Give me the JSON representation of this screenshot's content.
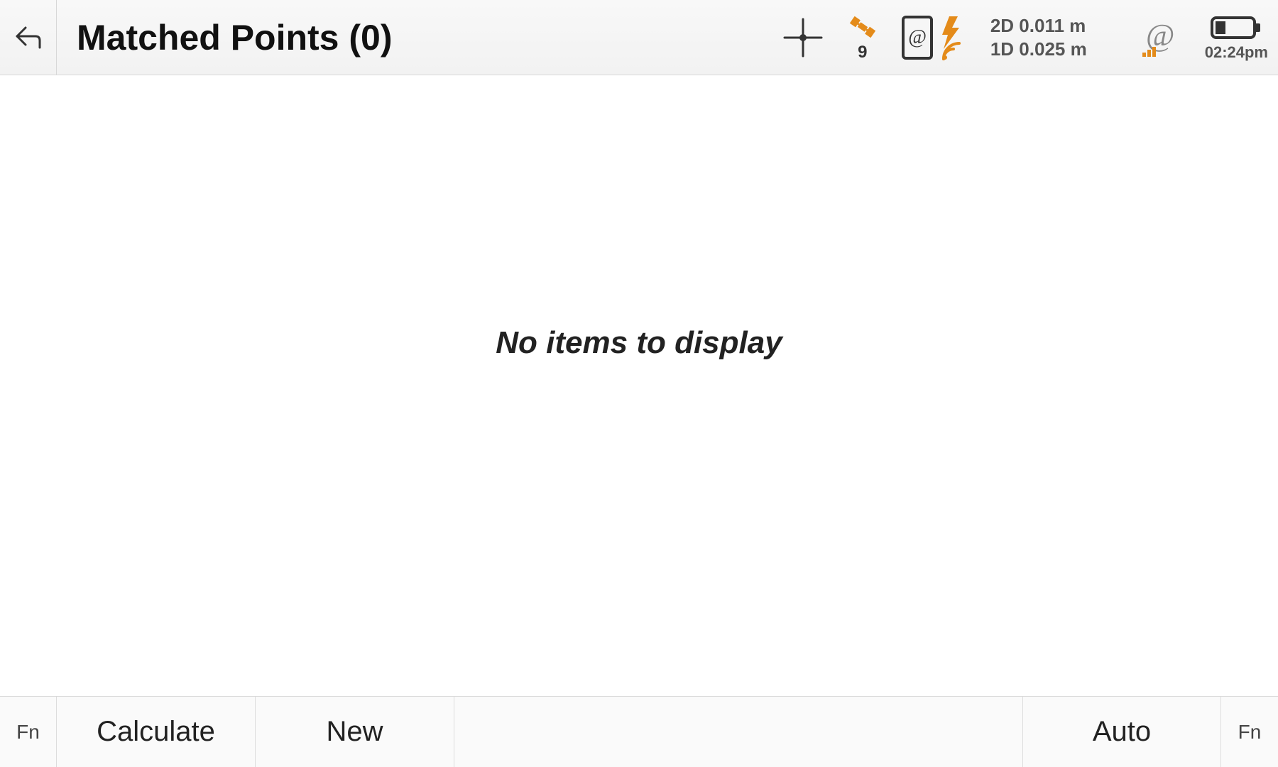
{
  "header": {
    "title": "Matched Points (0)",
    "satellites_count": "9",
    "accuracy_2d": "2D 0.011 m",
    "accuracy_1d": "1D 0.025 m",
    "time": "02:24pm"
  },
  "main": {
    "empty_message": "No items to display"
  },
  "footer": {
    "fn_left": "Fn",
    "calculate": "Calculate",
    "new": "New",
    "auto": "Auto",
    "fn_right": "Fn"
  },
  "colors": {
    "accent": "#e48b1a",
    "text_muted": "#555555"
  }
}
